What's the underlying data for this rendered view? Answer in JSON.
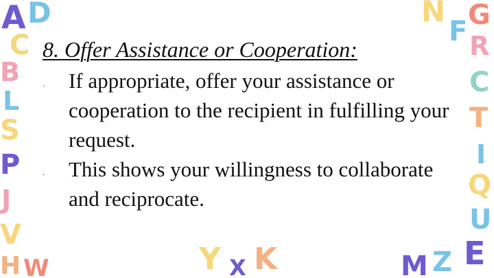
{
  "slide": {
    "title": "8. Offer Assistance or Cooperation:",
    "bullets": [
      {
        "marker": ".",
        "text": "If appropriate, offer your assistance or cooperation to the recipient in fulfilling your request."
      },
      {
        "marker": ".",
        "text": "This shows your willingness to collaborate and reciprocate."
      }
    ]
  },
  "decorations": {
    "left": [
      "A",
      "D",
      "C",
      "B",
      "L",
      "S",
      "P",
      "J",
      "V",
      "H",
      "W"
    ],
    "right": [
      "N",
      "G",
      "F",
      "R",
      "C",
      "T",
      "I",
      "Q",
      "U",
      "E"
    ],
    "bottom": [
      "Y",
      "X",
      "K",
      "M",
      "Z"
    ],
    "colors": {
      "purple": "#6d5bd0",
      "blue": "#79c3e6",
      "pink": "#f2a3b3",
      "yellow": "#f6d77c",
      "orange": "#f4b183",
      "teal": "#8fd3c8",
      "coral": "#f08a7a"
    }
  }
}
